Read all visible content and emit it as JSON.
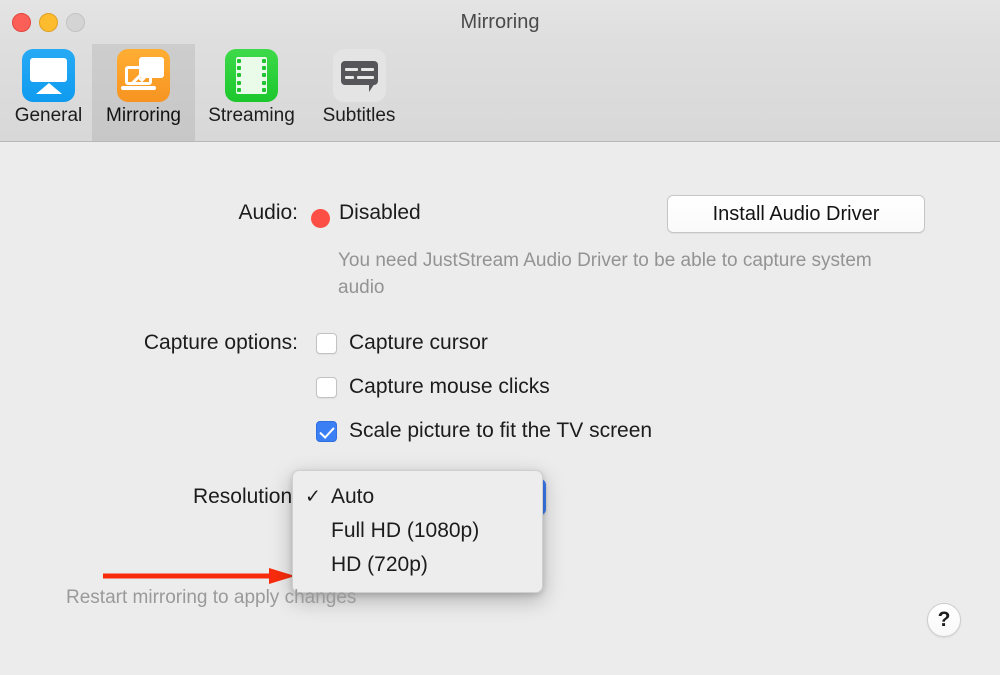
{
  "window": {
    "title": "Mirroring",
    "controls": {
      "close": "close-button",
      "minimize": "minimize-button",
      "zoom": "zoom-button"
    }
  },
  "toolbar": {
    "tabs": [
      {
        "label": "General",
        "icon": "airplay-icon",
        "selected": false
      },
      {
        "label": "Mirroring",
        "icon": "mirroring-icon",
        "selected": true
      },
      {
        "label": "Streaming",
        "icon": "film-icon",
        "selected": false
      },
      {
        "label": "Subtitles",
        "icon": "subtitles-icon",
        "selected": false
      }
    ]
  },
  "main": {
    "audio": {
      "label": "Audio:",
      "status": "Disabled",
      "status_color": "#fc4e44",
      "install_button": "Install Audio Driver",
      "hint": "You need JustStream Audio Driver to be able to capture system audio"
    },
    "capture": {
      "label": "Capture options:",
      "options": [
        {
          "label": "Capture cursor",
          "checked": false
        },
        {
          "label": "Capture mouse clicks",
          "checked": false
        },
        {
          "label": "Scale picture to fit the TV screen",
          "checked": true
        }
      ]
    },
    "resolution": {
      "label": "Resolution:",
      "selected": "Auto",
      "accent_color": "#3b7ff5",
      "menu_open": true,
      "options": [
        {
          "label": "Auto",
          "checked": true
        },
        {
          "label": "Full HD (1080p)",
          "checked": false
        },
        {
          "label": "HD (720p)",
          "checked": false
        }
      ]
    },
    "footer_note": "Restart mirroring to apply changes",
    "help_button": "?"
  },
  "annotation": {
    "arrow_color": "#f82c0c",
    "points_to": "Scale picture to fit the TV screen"
  }
}
